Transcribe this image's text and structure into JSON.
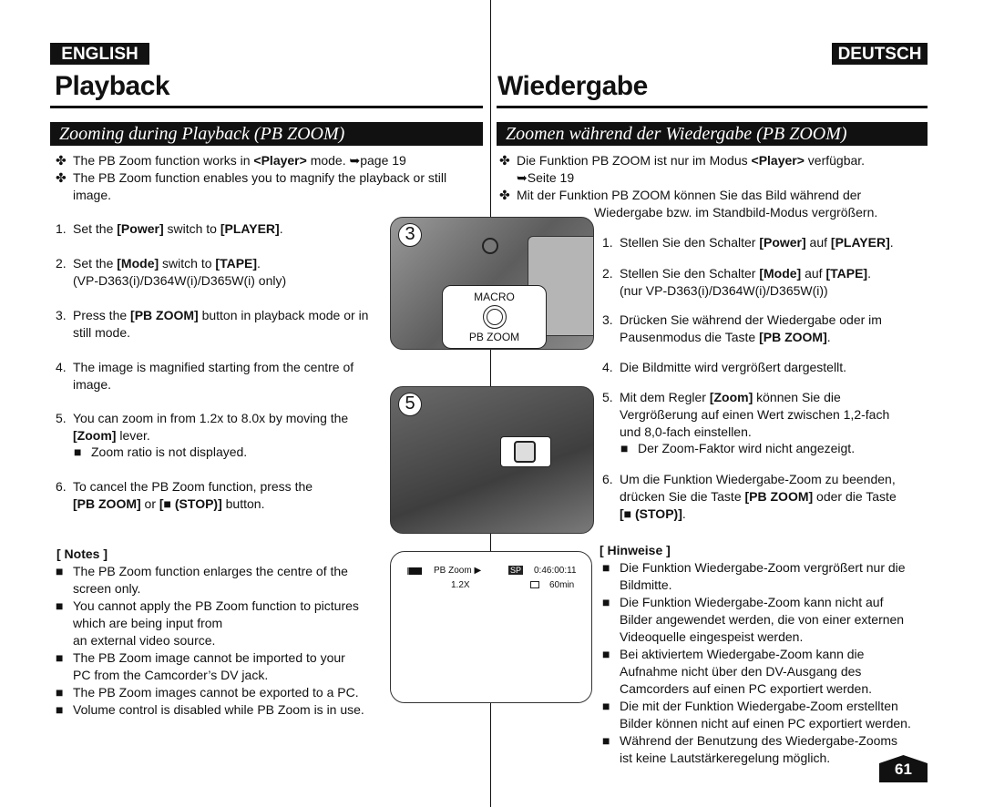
{
  "header": {
    "lang_left": "ENGLISH",
    "lang_right": "DEUTSCH",
    "title_left": "Playback",
    "title_right": "Wiedergabe",
    "section_left": "Zooming during Playback (PB ZOOM)",
    "section_right": "Zoomen während der Wiedergabe (PB ZOOM)"
  },
  "left": {
    "items": [
      {
        "mk": "✤",
        "seg": [
          {
            "t": "The PB Zoom function works in "
          },
          {
            "t": "<Player>",
            "b": true
          },
          {
            "t": " mode. ➥page 19"
          }
        ]
      },
      {
        "mk": "✤",
        "seg": [
          {
            "t": "The PB Zoom function enables you to magnify the playback or still\nimage."
          }
        ]
      },
      {
        "mk": "1.",
        "seg": [
          {
            "t": "Set the "
          },
          {
            "t": "[Power]",
            "b": true
          },
          {
            "t": " switch to "
          },
          {
            "t": "[PLAYER]",
            "b": true
          },
          {
            "t": "."
          }
        ]
      },
      {
        "mk": "2.",
        "seg": [
          {
            "t": "Set the "
          },
          {
            "t": "[Mode]",
            "b": true
          },
          {
            "t": " switch to "
          },
          {
            "t": "[TAPE]",
            "b": true
          },
          {
            "t": ".\n(VP-D363(i)/D364W(i)/D365W(i) only)"
          }
        ]
      },
      {
        "mk": "3.",
        "seg": [
          {
            "t": "Press the "
          },
          {
            "t": "[PB ZOOM]",
            "b": true
          },
          {
            "t": " button in playback mode or in\nstill mode."
          }
        ]
      },
      {
        "mk": "4.",
        "seg": [
          {
            "t": "The image is magnified starting from the centre of\nimage."
          }
        ]
      },
      {
        "mk": "5.",
        "seg": [
          {
            "t": "You can zoom in from 1.2x to 8.0x by moving the\n"
          },
          {
            "t": "[Zoom]",
            "b": true
          },
          {
            "t": " lever."
          }
        ]
      },
      {
        "mk": "■",
        "seg": [
          {
            "t": "Zoom ratio is not displayed."
          }
        ]
      },
      {
        "mk": "6.",
        "seg": [
          {
            "t": "To cancel the PB Zoom function, press the\n"
          },
          {
            "t": "[PB ZOOM]",
            "b": true
          },
          {
            "t": " or "
          },
          {
            "t": "[■ (STOP)]",
            "b": true
          },
          {
            "t": " button."
          }
        ]
      }
    ],
    "notes_title": "[ Notes ]",
    "notes": [
      "The PB Zoom function enlarges the centre of the\nscreen only.",
      "You cannot apply the PB Zoom function to pictures\nwhich are being input from\nan external video source.",
      "The PB Zoom image cannot be imported to your\nPC from the Camcorder’s DV jack.",
      "The PB Zoom images cannot be exported to a PC.",
      "Volume control is disabled while PB Zoom is in use."
    ]
  },
  "right": {
    "items": [
      {
        "mk": "✤",
        "seg": [
          {
            "t": "Die Funktion PB ZOOM ist nur im Modus "
          },
          {
            "t": "<Player>",
            "b": true
          },
          {
            "t": " verfügbar.\n➥Seite 19"
          }
        ]
      },
      {
        "mk": "✤",
        "seg": [
          {
            "t": "Mit der Funktion PB ZOOM können Sie das Bild während der"
          }
        ]
      },
      {
        "mk": "",
        "seg": [
          {
            "t": "Wiedergabe bzw. im Standbild-Modus vergrößern."
          }
        ]
      },
      {
        "mk": "1.",
        "seg": [
          {
            "t": "Stellen Sie den Schalter "
          },
          {
            "t": "[Power]",
            "b": true
          },
          {
            "t": " auf "
          },
          {
            "t": "[PLAYER]",
            "b": true
          },
          {
            "t": "."
          }
        ]
      },
      {
        "mk": "2.",
        "seg": [
          {
            "t": "Stellen Sie den Schalter "
          },
          {
            "t": "[Mode]",
            "b": true
          },
          {
            "t": " auf "
          },
          {
            "t": "[TAPE]",
            "b": true
          },
          {
            "t": ".\n(nur VP-D363(i)/D364W(i)/D365W(i))"
          }
        ]
      },
      {
        "mk": "3.",
        "seg": [
          {
            "t": "Drücken Sie während der Wiedergabe oder im\nPausenmodus die Taste "
          },
          {
            "t": "[PB ZOOM]",
            "b": true
          },
          {
            "t": "."
          }
        ]
      },
      {
        "mk": "4.",
        "seg": [
          {
            "t": "Die Bildmitte wird vergrößert dargestellt."
          }
        ]
      },
      {
        "mk": "5.",
        "seg": [
          {
            "t": "Mit dem Regler "
          },
          {
            "t": "[Zoom]",
            "b": true
          },
          {
            "t": " können Sie die\nVergrößerung auf einen Wert zwischen 1,2-fach\nund 8,0-fach einstellen."
          }
        ]
      },
      {
        "mk": "■",
        "seg": [
          {
            "t": "Der Zoom-Faktor wird nicht angezeigt."
          }
        ]
      },
      {
        "mk": "6.",
        "seg": [
          {
            "t": "Um die Funktion Wiedergabe-Zoom zu beenden,\ndrücken Sie die Taste "
          },
          {
            "t": "[PB ZOOM]",
            "b": true
          },
          {
            "t": " oder die Taste\n"
          },
          {
            "t": "[■ (STOP)]",
            "b": true
          },
          {
            "t": "."
          }
        ]
      }
    ],
    "notes_title": "[ Hinweise ]",
    "notes": [
      "Die Funktion Wiedergabe-Zoom vergrößert nur die\nBildmitte.",
      "Die Funktion Wiedergabe-Zoom kann nicht auf\nBilder angewendet werden, die von einer externen\nVideoquelle eingespeist werden.",
      "Bei aktiviertem Wiedergabe-Zoom kann die\nAufnahme nicht über den DV-Ausgang des\nCamcorders auf einen PC exportiert werden.",
      "Die mit der Funktion Wiedergabe-Zoom erstellten\nBilder können nicht auf einen PC exportiert werden.",
      "Während der Benutzung des Wiedergabe-Zooms\nist keine Lautstärkeregelung möglich."
    ]
  },
  "figures": {
    "step3": "3",
    "step5": "5",
    "macro": "MACRO",
    "pbzoom": "PB ZOOM",
    "screen": {
      "mode": "PB Zoom ▶",
      "zoom": "1.2X",
      "sp": "SP",
      "time": "0:46:00:11",
      "remain": "60min"
    }
  },
  "page_number": "61"
}
